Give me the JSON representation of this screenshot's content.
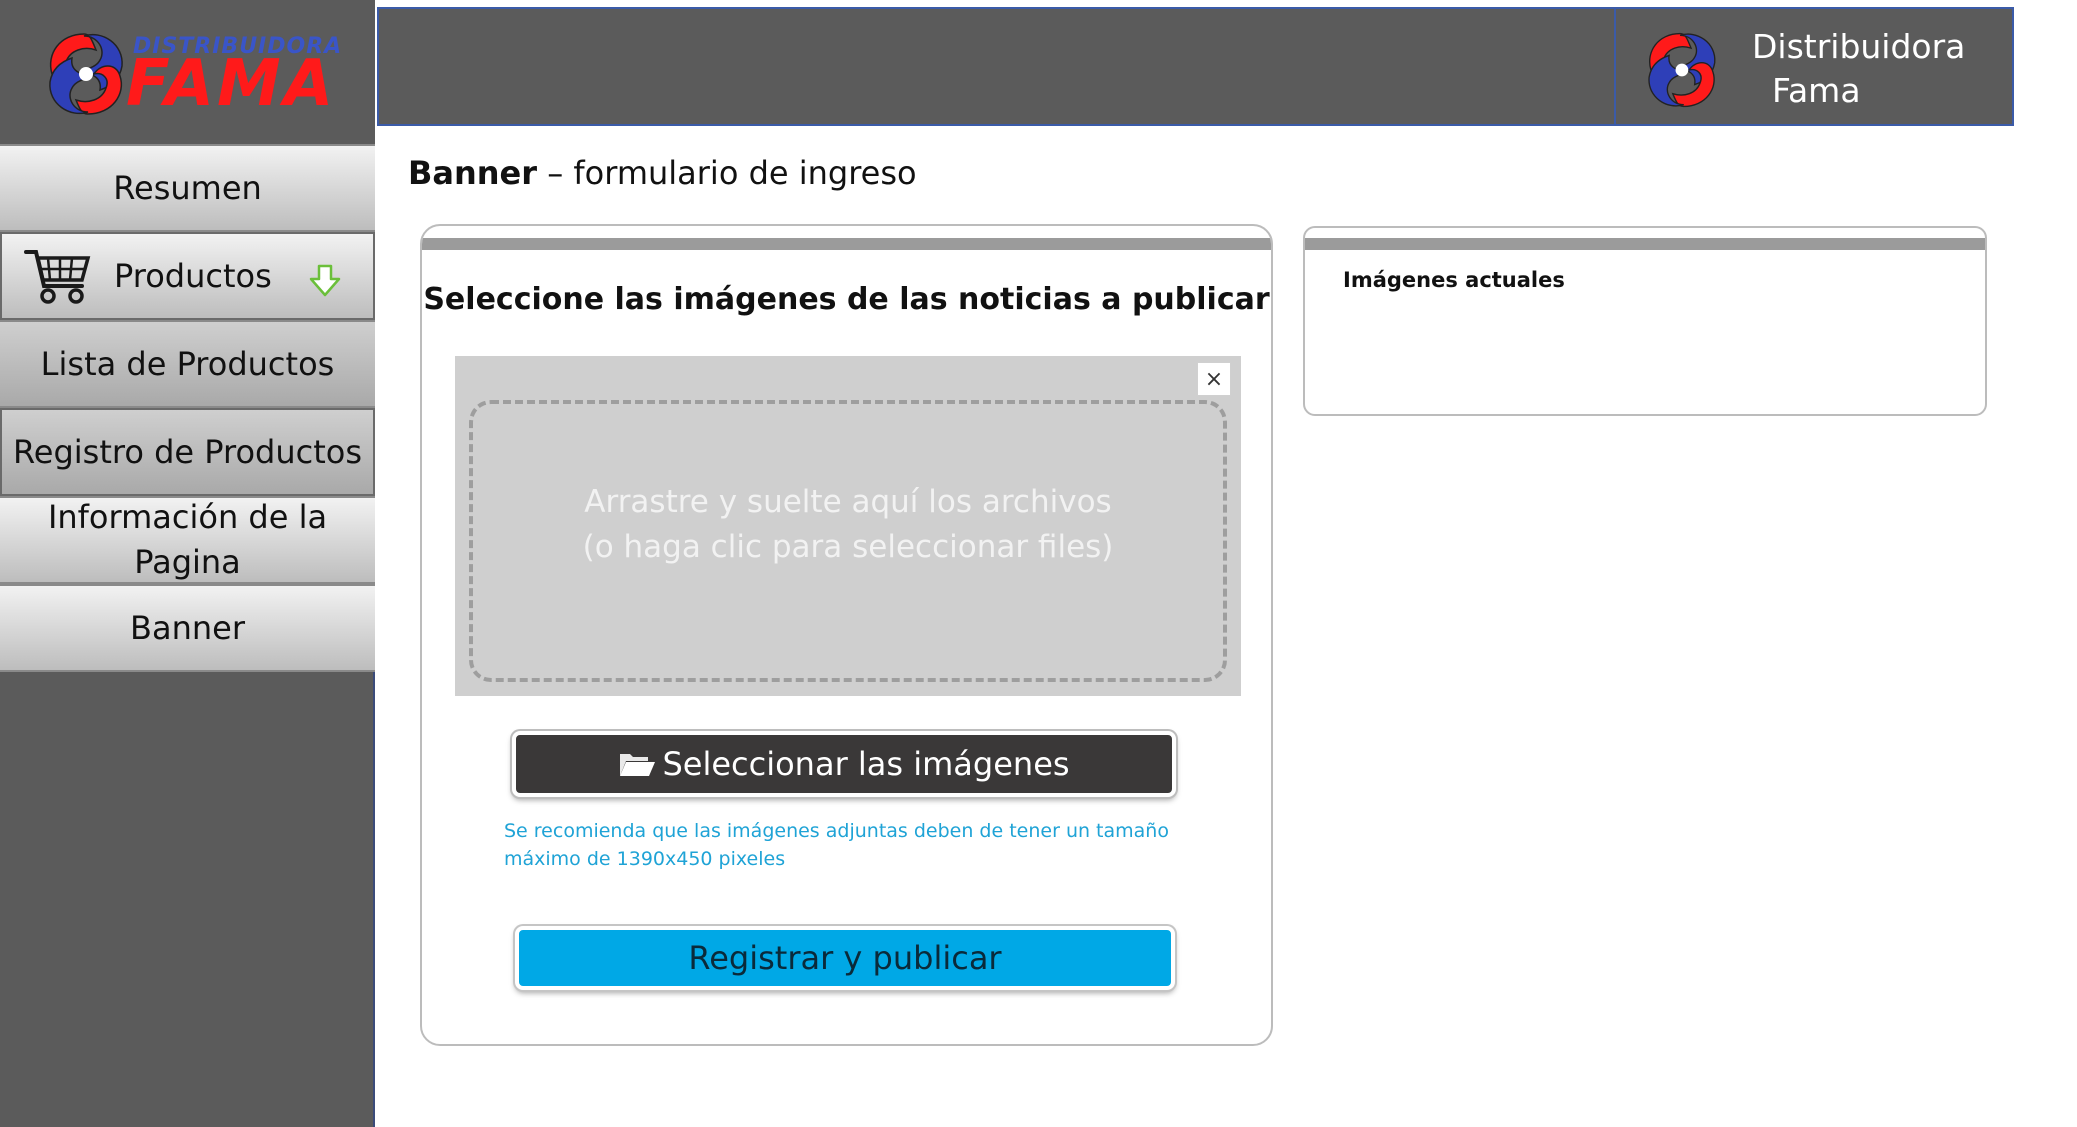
{
  "brand": {
    "logo_small": "DISTRIBUIDORA",
    "logo_big": "FAMA",
    "name_line1": "Distribuidora",
    "name_line2": "Fama"
  },
  "sidebar": {
    "items": [
      {
        "label": "Resumen"
      },
      {
        "label": "Productos",
        "icon": "cart-icon",
        "expand_icon": "arrow-down-icon"
      },
      {
        "label": "Lista de Productos"
      },
      {
        "label": "Registro de Productos"
      },
      {
        "label": "Información de la Pagina"
      },
      {
        "label": "Banner"
      }
    ]
  },
  "page": {
    "title_bold": "Banner",
    "title_rest": " – formulario de ingreso"
  },
  "form": {
    "heading": "Seleccione las imágenes de las noticias a publicar",
    "dropzone_line1": "Arrastre y suelte aquí los archivos",
    "dropzone_line2": "(o haga clic para seleccionar files)",
    "close_label": "×",
    "select_button": "Seleccionar las imágenes",
    "hint": "Se recomienda que las imágenes adjuntas deben de tener un tamaño máximo de 1390x450 pixeles",
    "register_button": "Registrar y publicar"
  },
  "current_images": {
    "title": "Imágenes actuales"
  },
  "colors": {
    "sidebar_bg": "#5b5b5b",
    "accent_blue": "#00a8e6",
    "hint_blue": "#1fa3d6",
    "logo_red": "#ff1a1a",
    "logo_blue": "#3a55c8"
  }
}
